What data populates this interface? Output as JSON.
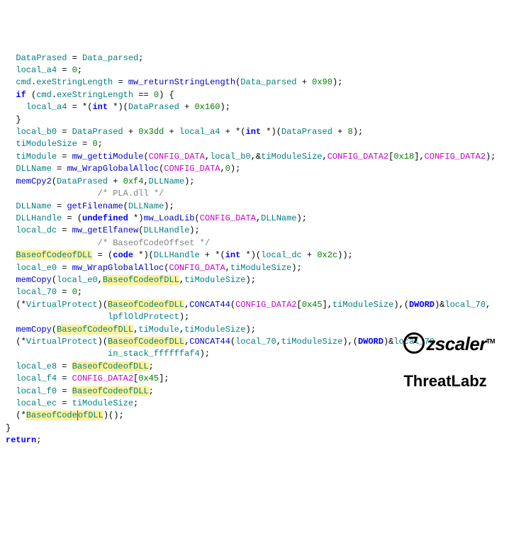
{
  "code": {
    "l1": {
      "a": "DataPrased",
      "b": "Data_parsed"
    },
    "l2": {
      "a": "local_a4",
      "b": "0"
    },
    "l3": {
      "a": "cmd",
      "b": "exeStringLength",
      "c": "mw_returnStringLength",
      "d": "Data_parsed",
      "e": "0x90"
    },
    "l4": {
      "a": "if",
      "b": "cmd",
      "c": "exeStringLength",
      "d": "0"
    },
    "l5": {
      "a": "local_a4",
      "b": "int",
      "c": "DataPrased",
      "d": "0x160"
    },
    "l7": {
      "a": "local_b0",
      "b": "DataPrased",
      "c": "0x3dd",
      "d": "local_a4",
      "e": "int",
      "f": "DataPrased",
      "g": "8"
    },
    "l8": {
      "a": "tiModuleSize",
      "b": "0"
    },
    "l9": {
      "a": "tiModule",
      "b": "mw_gettiModule",
      "c": "CONFIG_DATA",
      "d": "local_b0",
      "e": "tiModuleSize",
      "f": "CONFIG_DATA2",
      "g": "0x18",
      "h": "CONFIG_DATA2"
    },
    "l10": {
      "a": "DLLName",
      "b": "mw_WrapGlobalAlloc",
      "c": "CONFIG_DATA",
      "d": "0"
    },
    "l11": {
      "a": "memCpy2",
      "b": "DataPrased",
      "c": "0xf4",
      "d": "DLLName"
    },
    "l12": {
      "a": "/* PLA.dll */"
    },
    "l13": {
      "a": "DLLName",
      "b": "getFilename",
      "c": "DLLName"
    },
    "l14": {
      "a": "DLLHandle",
      "b": "undefined",
      "c": "mw_LoadLib",
      "d": "CONFIG_DATA",
      "e": "DLLName"
    },
    "l15": {
      "a": "local_dc",
      "b": "mw_getElfanew",
      "c": "DLLHandle"
    },
    "l16": {
      "a": "/* BaseofCodeOffset */"
    },
    "l17": {
      "a": "BaseofCodeofDLL",
      "b": "code",
      "c": "DLLHandle",
      "d": "int",
      "e": "local_dc",
      "f": "0x2c"
    },
    "l18": {
      "a": "local_e0",
      "b": "mw_WrapGlobalAlloc",
      "c": "CONFIG_DATA",
      "d": "tiModuleSize"
    },
    "l19": {
      "a": "memCopy",
      "b": "local_e0",
      "c": "BaseofCodeofDLL",
      "d": "tiModuleSize"
    },
    "l20": {
      "a": "local_70",
      "b": "0"
    },
    "l21": {
      "a": "VirtualProtect",
      "b": "BaseofCodeofDLL",
      "c": "CONCAT44",
      "d": "CONFIG_DATA2",
      "e": "0x45",
      "f": "tiModuleSize",
      "g": "DWORD",
      "h": "local_70"
    },
    "l22": {
      "a": "lpflOldProtect"
    },
    "l23": {
      "a": "memCopy",
      "b": "BaseofCodeofDLL",
      "c": "tiModule",
      "d": "tiModuleSize"
    },
    "l24": {
      "a": "VirtualProtect",
      "b": "BaseofCodeofDLL",
      "c": "CONCAT44",
      "d": "local_70",
      "e": "tiModuleSize",
      "f": "DWORD",
      "g": "local_70"
    },
    "l25": {
      "a": "in_stack_ffffffaf4"
    },
    "l26": {
      "a": "local_e8",
      "b": "BaseofCodeofDLL"
    },
    "l27": {
      "a": "local_f4",
      "b": "CONFIG_DATA2",
      "c": "0x45"
    },
    "l28": {
      "a": "local_f0",
      "b": "BaseofCodeofDLL"
    },
    "l29": {
      "a": "local_ec",
      "b": "tiModuleSize"
    },
    "l30": {
      "a": "BaseofCode",
      "b": "ofDLL"
    },
    "l32": {
      "a": "return"
    }
  },
  "logo": {
    "brand": "zscaler",
    "sub": "ThreatLabz",
    "tm": "TM"
  }
}
